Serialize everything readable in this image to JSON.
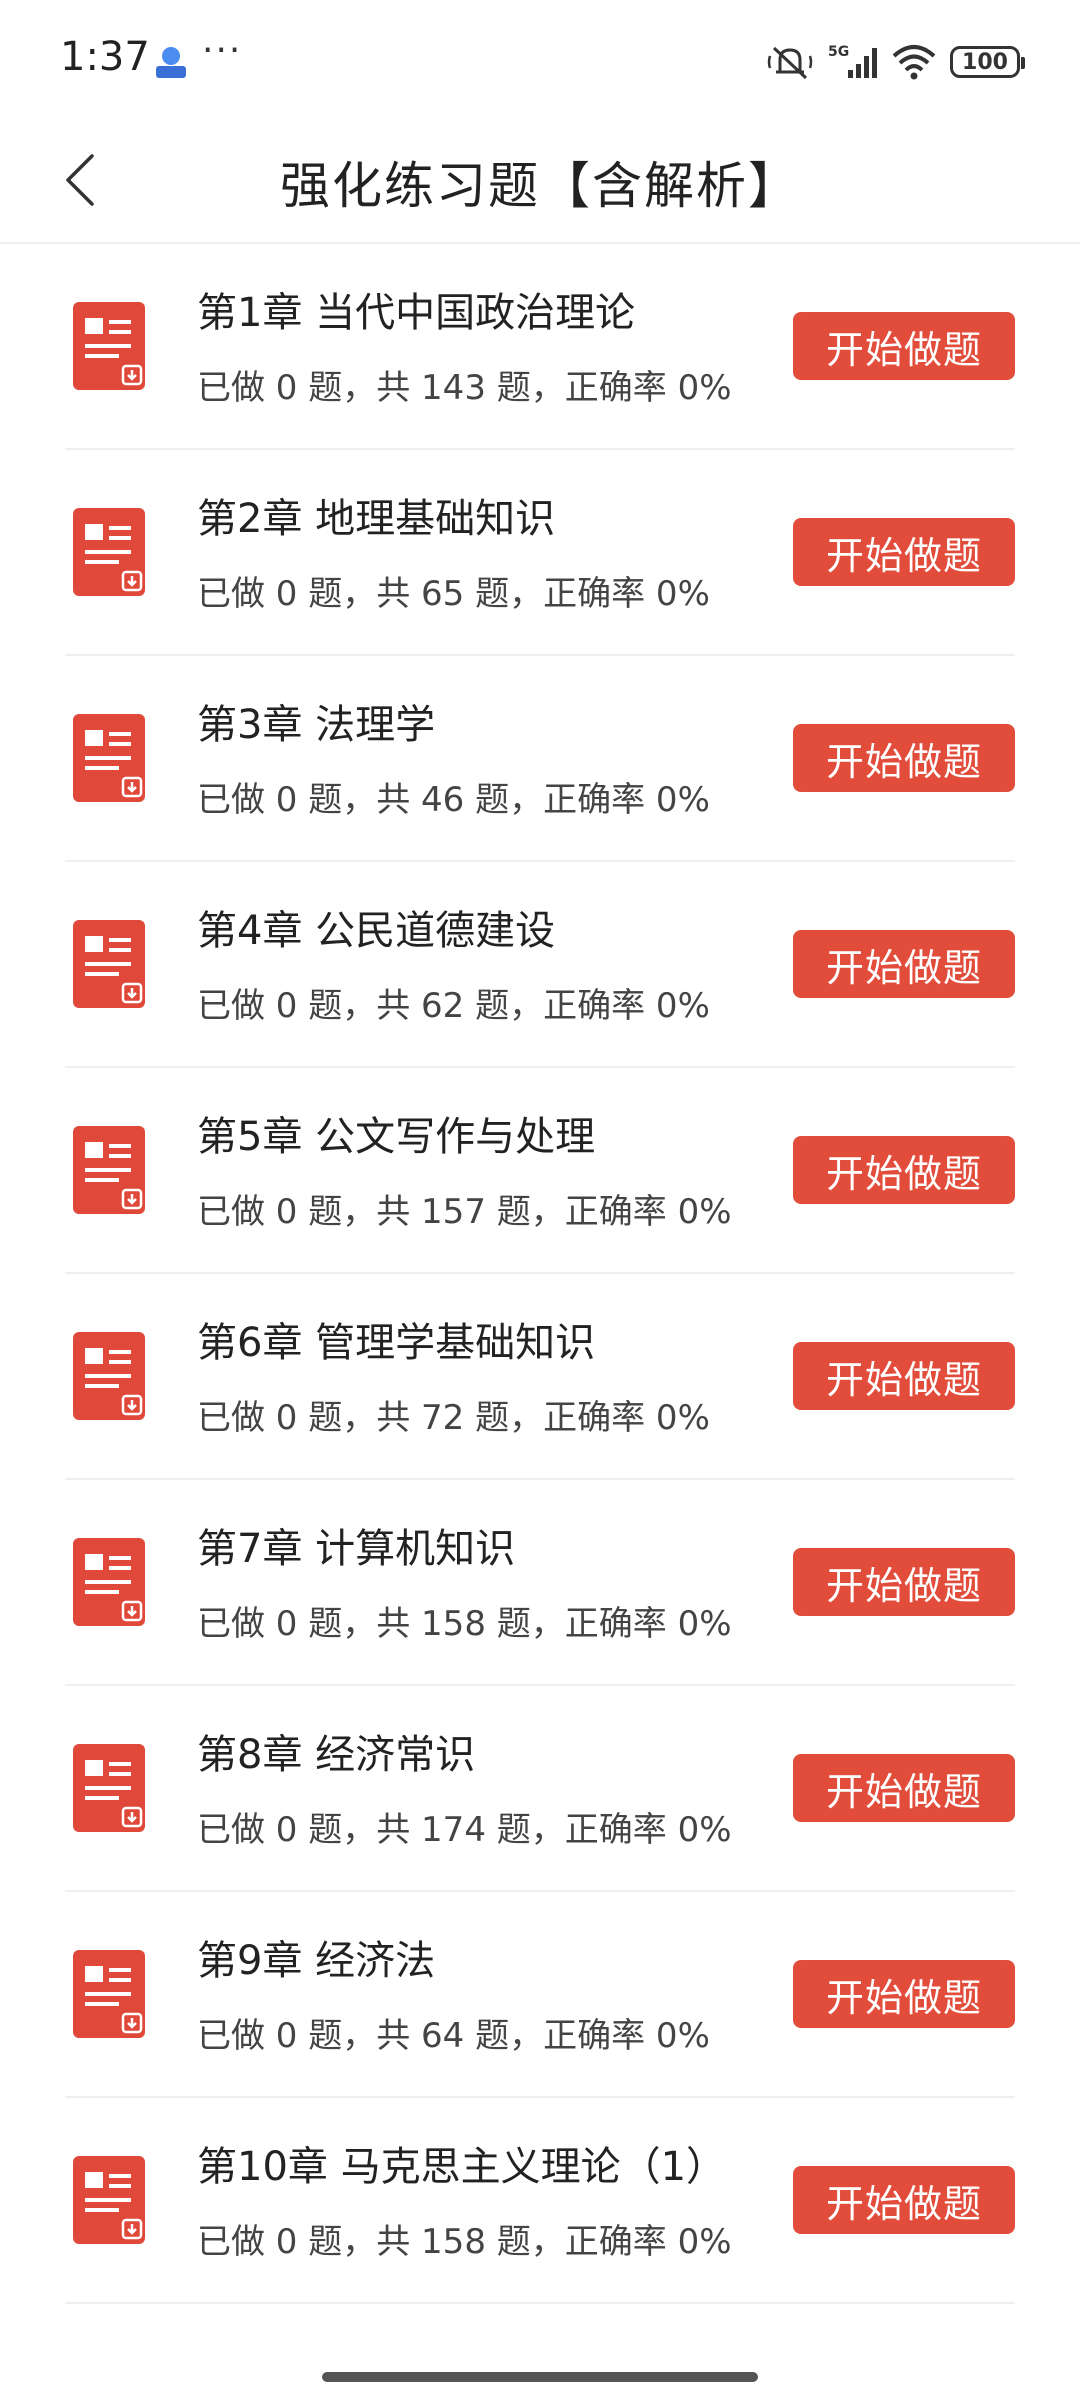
{
  "status_bar": {
    "time": "1:37",
    "more": "···",
    "network": "5G",
    "battery": "100"
  },
  "header": {
    "title": "强化练习题【含解析】"
  },
  "chapters": [
    {
      "title": "第1章 当代中国政治理论",
      "stats": "已做 0 题，共 143 题，正确率 0%",
      "button": "开始做题"
    },
    {
      "title": "第2章 地理基础知识",
      "stats": "已做 0 题，共 65 题，正确率 0%",
      "button": "开始做题"
    },
    {
      "title": "第3章 法理学",
      "stats": "已做 0 题，共 46 题，正确率 0%",
      "button": "开始做题"
    },
    {
      "title": "第4章 公民道德建设",
      "stats": "已做 0 题，共 62 题，正确率 0%",
      "button": "开始做题"
    },
    {
      "title": "第5章 公文写作与处理",
      "stats": "已做 0 题，共 157 题，正确率 0%",
      "button": "开始做题"
    },
    {
      "title": "第6章 管理学基础知识",
      "stats": "已做 0 题，共 72 题，正确率 0%",
      "button": "开始做题"
    },
    {
      "title": "第7章 计算机知识",
      "stats": "已做 0 题，共 158 题，正确率 0%",
      "button": "开始做题"
    },
    {
      "title": "第8章 经济常识",
      "stats": "已做 0 题，共 174 题，正确率 0%",
      "button": "开始做题"
    },
    {
      "title": "第9章 经济法",
      "stats": "已做 0 题，共 64 题，正确率 0%",
      "button": "开始做题"
    },
    {
      "title": "第10章 马克思主义理论（1）",
      "stats": "已做 0 题，共 158 题，正确率 0%",
      "button": "开始做题"
    }
  ],
  "colors": {
    "accent": "#e24c3b",
    "icon_red": "#e0483a"
  },
  "icons": {
    "back": "chevron-left-icon",
    "document": "document-icon",
    "wifi": "wifi-icon",
    "signal": "signal-icon",
    "mute": "mute-icon"
  }
}
